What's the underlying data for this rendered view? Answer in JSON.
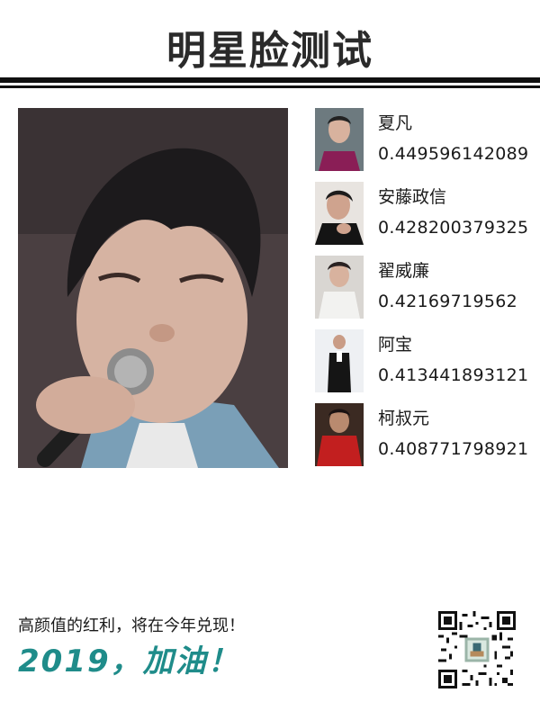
{
  "title": "明星脸测试",
  "matches": [
    {
      "name": "夏凡",
      "score": "0.449596142089"
    },
    {
      "name": "安藤政信",
      "score": "0.428200379325"
    },
    {
      "name": "翟威廉",
      "score": "0.42169719562"
    },
    {
      "name": "阿宝",
      "score": "0.413441893121"
    },
    {
      "name": "柯叔元",
      "score": "0.408771798921"
    }
  ],
  "footer": {
    "line1": "高颜值的红利，将在今年兑现！",
    "line2": "2019，加油！"
  },
  "colors": {
    "accent": "#1f8c8a",
    "title": "#2a2a2a"
  },
  "icons": [
    "main-photo",
    "thumbnail",
    "qr-code"
  ]
}
